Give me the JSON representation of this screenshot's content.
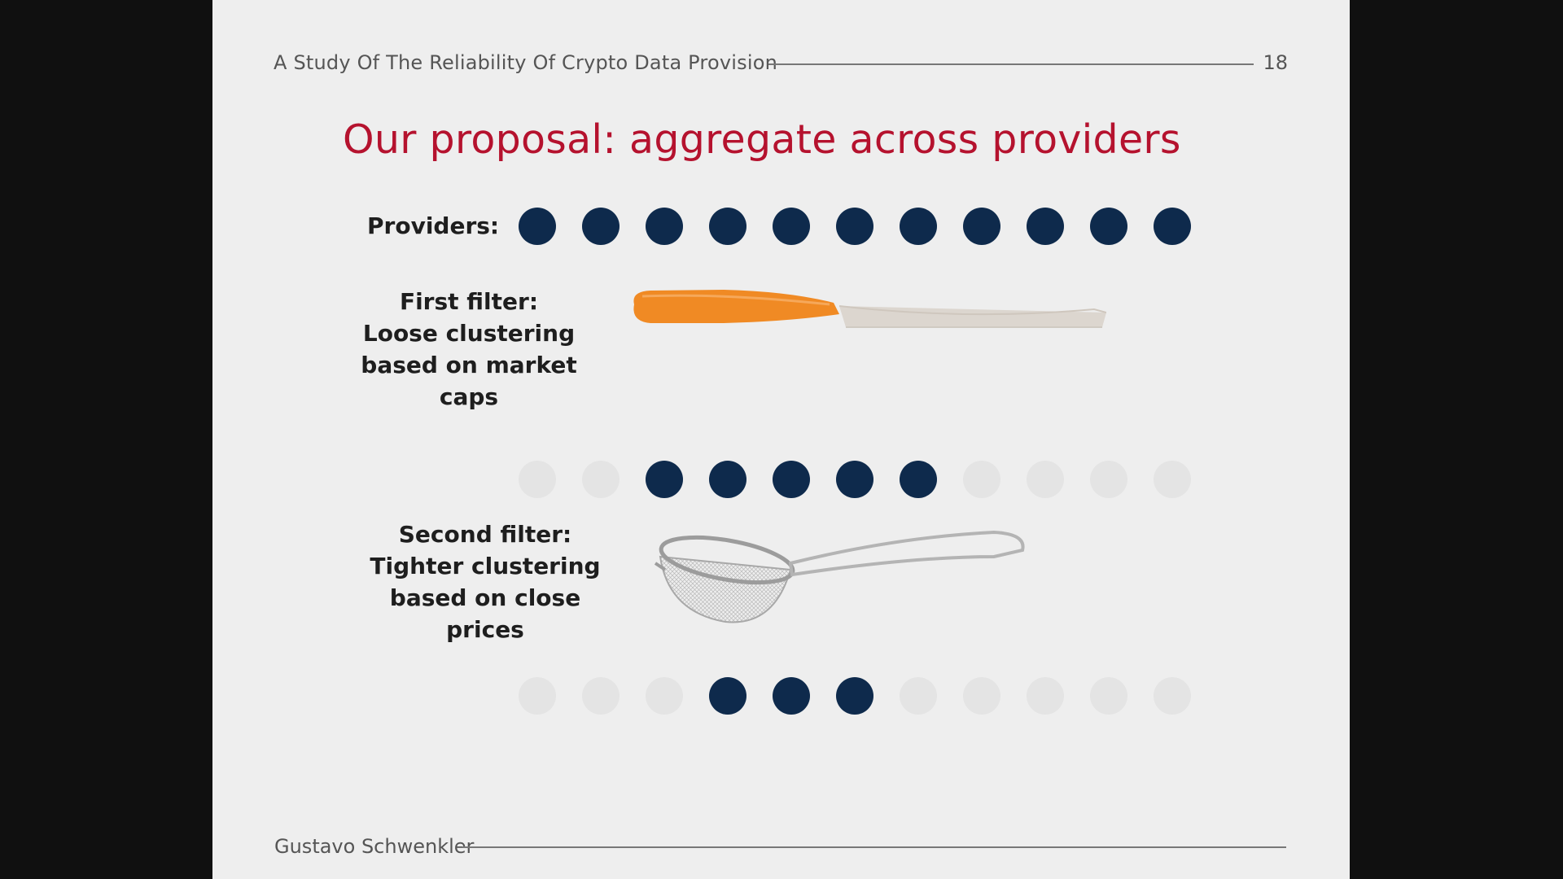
{
  "header": {
    "title": "A Study Of The Reliability Of Crypto Data Provision",
    "page_number": "18"
  },
  "slide": {
    "title": "Our proposal: aggregate across providers",
    "providers_label": "Providers:",
    "provider_count": 11,
    "first_filter": {
      "lines": [
        "First filter:",
        "Loose clustering",
        "based on market",
        "caps"
      ],
      "icon": "knife-icon",
      "remaining_count": 5
    },
    "second_filter": {
      "lines": [
        "Second filter:",
        "Tighter clustering",
        "based on close",
        "prices"
      ],
      "icon": "strainer-icon",
      "remaining_count": 3
    }
  },
  "footer": {
    "author": "Gustavo Schwenkler"
  },
  "colors": {
    "title": "#b5122e",
    "dot": "#0e2a4c",
    "knife_handle": "#f08a24",
    "background": "#eeeeee"
  }
}
